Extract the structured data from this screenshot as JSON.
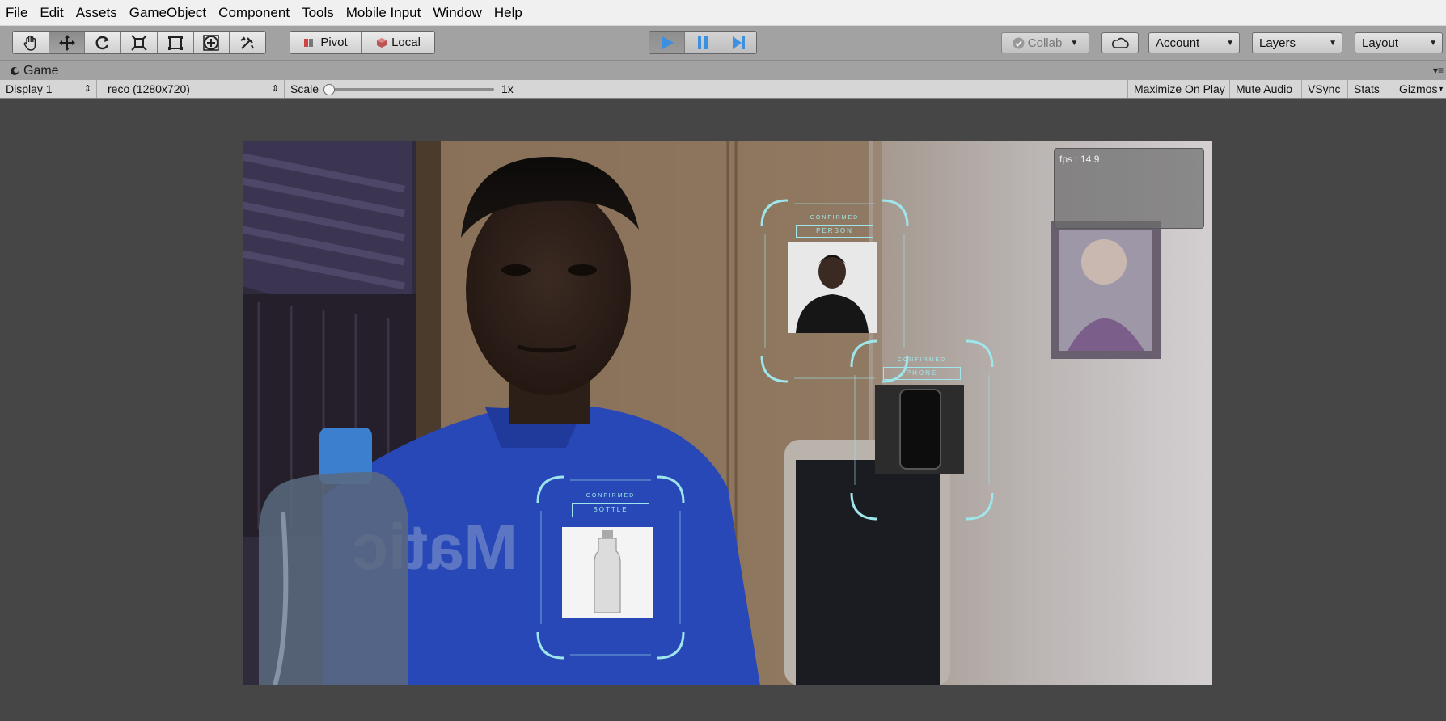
{
  "menu": [
    "File",
    "Edit",
    "Assets",
    "GameObject",
    "Component",
    "Tools",
    "Mobile Input",
    "Window",
    "Help"
  ],
  "toolbar": {
    "tools": [
      {
        "icon": "hand-icon"
      },
      {
        "icon": "move-icon"
      },
      {
        "icon": "rotate-icon"
      },
      {
        "icon": "scale-icon"
      },
      {
        "icon": "rect-tool-icon"
      },
      {
        "icon": "transform-tool-icon"
      },
      {
        "icon": "custom-tool-icon"
      }
    ],
    "pivot_label": "Pivot",
    "local_label": "Local",
    "collab_label": "Collab",
    "account_label": "Account",
    "layers_label": "Layers",
    "layout_label": "Layout"
  },
  "game_tab": {
    "label": "Game"
  },
  "game_bar": {
    "display": "Display 1",
    "resolution": "reco (1280x720)",
    "scale_label": "Scale",
    "scale_value": "1x",
    "scale_fraction": 0.0,
    "maximize": "Maximize On Play",
    "mute": "Mute Audio",
    "vsync": "VSync",
    "stats": "Stats",
    "gizmos": "Gizmos"
  },
  "hud": {
    "fps": "fps : 14.9",
    "cards": [
      {
        "status": "CONFIRMED",
        "label": "PERSON"
      },
      {
        "status": "CONFIRMED",
        "label": "PHONE"
      },
      {
        "status": "CONFIRMED",
        "label": "BOTTLE"
      }
    ]
  },
  "colors": {
    "accent_blue": "#3d8fe0",
    "hud_cyan": "#9fe6ea",
    "shirt_blue": "#2848b8"
  }
}
